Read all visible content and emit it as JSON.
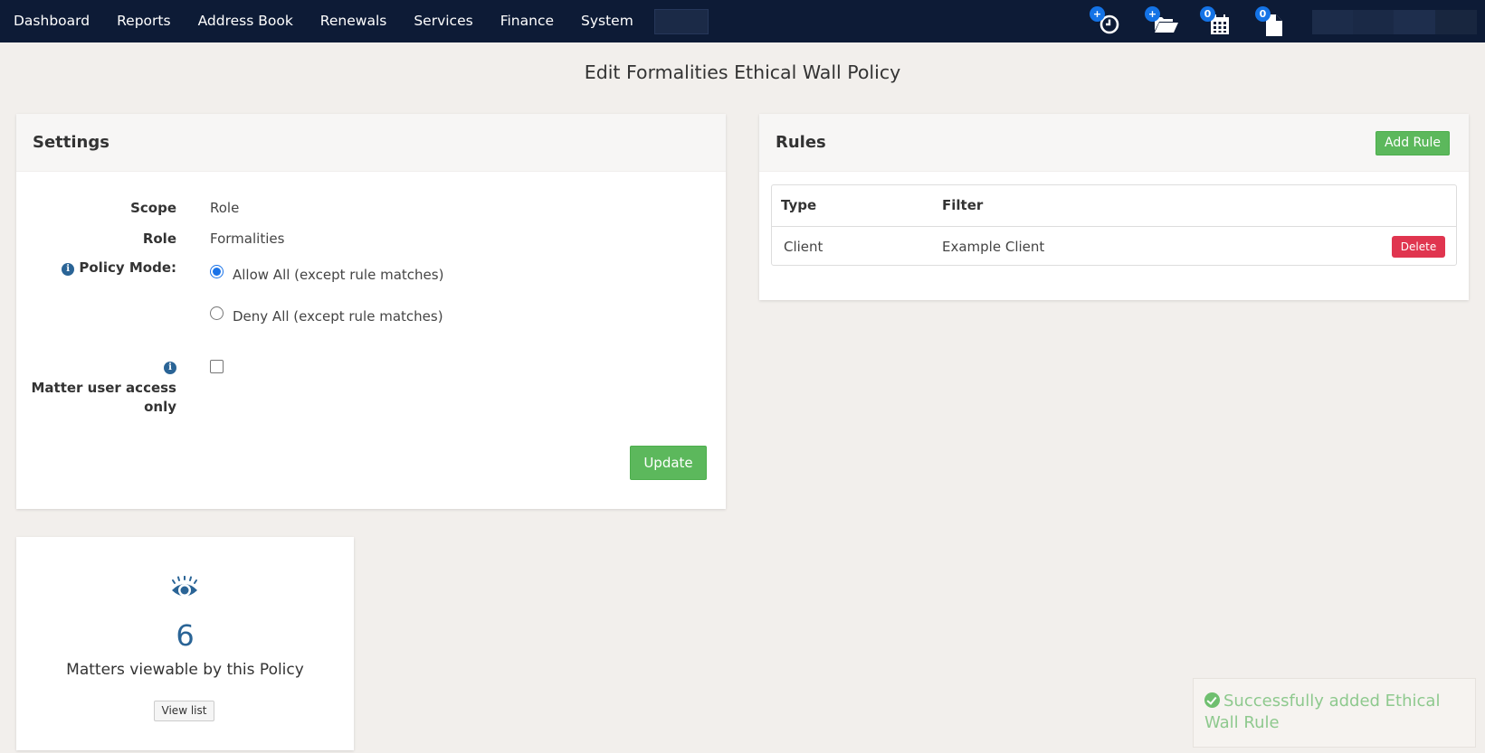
{
  "nav": {
    "items": [
      "Dashboard",
      "Reports",
      "Address Book",
      "Renewals",
      "Services",
      "Finance",
      "System"
    ],
    "icons": [
      {
        "name": "new-timer-icon",
        "badge": "+"
      },
      {
        "name": "new-matter-folder-icon",
        "badge": "+"
      },
      {
        "name": "calendar-icon",
        "badge": "0"
      },
      {
        "name": "document-icon",
        "badge": "0"
      }
    ]
  },
  "page": {
    "title": "Edit Formalities Ethical Wall Policy"
  },
  "settings": {
    "header": "Settings",
    "scope_label": "Scope",
    "scope_value": "Role",
    "role_label": "Role",
    "role_value": "Formalities",
    "policy_mode_label": "Policy Mode:",
    "policy_options": [
      {
        "label": "Allow All (except rule matches)",
        "checked": true
      },
      {
        "label": "Deny All (except rule matches)",
        "checked": false
      }
    ],
    "matter_user_label": "Matter user access only",
    "matter_user_checked": false,
    "update_label": "Update"
  },
  "rules": {
    "header": "Rules",
    "add_label": "Add Rule",
    "columns": [
      "Type",
      "Filter"
    ],
    "rows": [
      {
        "type": "Client",
        "filter": "Example Client",
        "action": "Delete"
      }
    ]
  },
  "matters": {
    "icon": "eye-icon",
    "count": "6",
    "label": "Matters viewable by this Policy",
    "view_label": "View list"
  },
  "toast": {
    "message": "Successfully added Ethical Wall Rule"
  },
  "colors": {
    "nav_bg": "#0d1b36",
    "page_bg": "#f2efec",
    "success": "#5cb85c",
    "danger": "#e0354f",
    "badge": "#1473e6",
    "accent": "#2a6496"
  }
}
